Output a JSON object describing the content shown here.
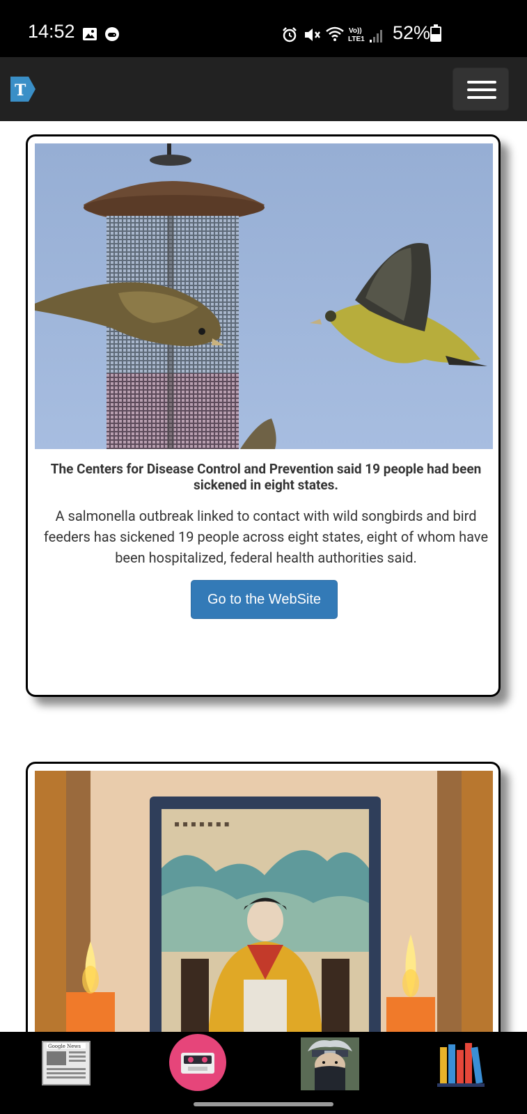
{
  "status_bar": {
    "time": "14:52",
    "battery": "52%",
    "icons": [
      "image-icon",
      "game-icon",
      "alarm-icon",
      "mute-icon",
      "wifi-icon",
      "lte-icon",
      "signal-icon",
      "battery-icon"
    ]
  },
  "navbar": {
    "logo": "times-t-logo-icon",
    "menu": "hamburger-menu-icon"
  },
  "articles": [
    {
      "image": "birds-at-feeder",
      "title": "The Centers for Disease Control and Prevention said 19 people had been sickened in eight states.",
      "text": "A salmonella outbreak linked to contact with wild songbirds and bird feeders has sickened 19 people across eight states, eight of whom have been hospitalized, federal health authorities said.",
      "button_label": "Go to the WebSite"
    },
    {
      "image": "portrait-shrine-with-candles"
    }
  ],
  "bottom_nav": {
    "items": [
      {
        "name": "google-news-icon",
        "label": "Google News"
      },
      {
        "name": "cassette-icon"
      },
      {
        "name": "kakashi-avatar-icon"
      },
      {
        "name": "books-icon"
      }
    ]
  },
  "colors": {
    "navbar_bg": "#222222",
    "button_primary": "#337ab7",
    "cassette_accent": "#e6457a"
  }
}
